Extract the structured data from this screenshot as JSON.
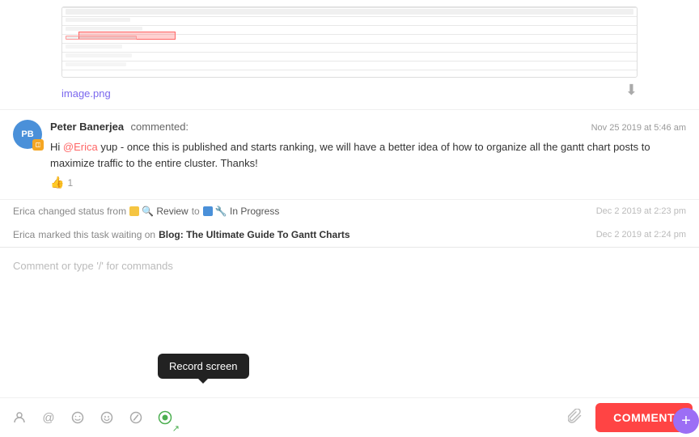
{
  "image": {
    "filename": "image.png",
    "download_label": "⬇"
  },
  "comment": {
    "avatar_initials": "PB",
    "commenter_name": "Peter Banerjea",
    "commented_label": "commented:",
    "timestamp": "Nov 25 2019 at 5:46 am",
    "mention": "@Erica",
    "text_before_mention": "Hi ",
    "text_after_mention": " yup - once this is published and starts ranking, we will have a better idea of how to organize all the gantt chart posts to maximize traffic to the entire cluster. Thanks!",
    "like_count": "1"
  },
  "activity": [
    {
      "actor": "Erica",
      "action": "changed status from",
      "from_status": "Review",
      "to_word": "to",
      "to_status": "In Progress",
      "timestamp": "Dec 2 2019 at 2:23 pm"
    },
    {
      "actor": "Erica",
      "action": "marked this task waiting on",
      "task_name": "Blog: The Ultimate Guide To Gantt Charts",
      "timestamp": "Dec 2 2019 at 2:24 pm"
    }
  ],
  "comment_input": {
    "placeholder": "Comment or type '/' for commands"
  },
  "toolbar": {
    "record_tooltip": "Record screen",
    "comment_button_label": "COMMENT",
    "icons": [
      {
        "name": "person-icon",
        "symbol": "👤"
      },
      {
        "name": "at-icon",
        "symbol": "@"
      },
      {
        "name": "emoji-icon",
        "symbol": "☺"
      },
      {
        "name": "smile-icon",
        "symbol": "😊"
      },
      {
        "name": "slash-icon",
        "symbol": "⊘"
      },
      {
        "name": "record-icon",
        "symbol": "⏺"
      }
    ]
  },
  "colors": {
    "comment_button_bg": "#ff3333",
    "mention_color": "#ff6666",
    "avatar_bg": "#4a90d9",
    "badge_bg": "#f5a623",
    "record_active": "#4caf50",
    "fab_bg": "#9c6ef5"
  }
}
